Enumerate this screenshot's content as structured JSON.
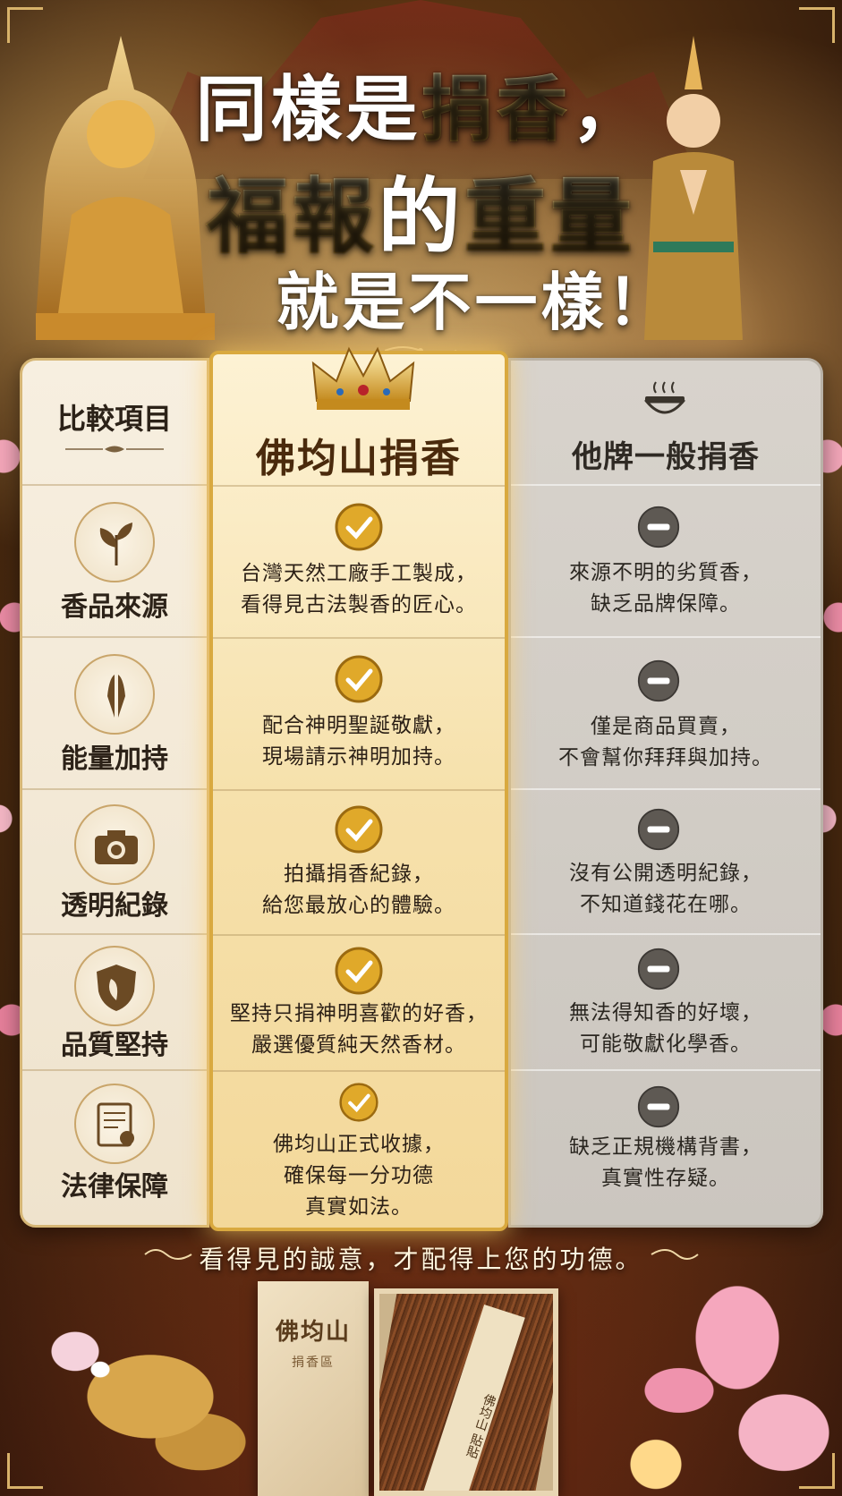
{
  "headline": {
    "line1_part1": "同樣是",
    "line1_part2": "捐香",
    "line1_punct": "，",
    "line2_part1": "福報",
    "line2_part2": "的",
    "line2_part3": "重量",
    "line3": "就是不一樣！"
  },
  "table": {
    "header_label": "比較項目",
    "header_brand": "佛均山捐香",
    "header_other": "他牌一般捐香",
    "rows": [
      {
        "label": "香品來源",
        "icon": "leaf-icon",
        "brand_line1": "台灣天然工廠手工製成，",
        "brand_line2": "看得見古法製香的匠心。",
        "other_line1": "來源不明的劣質香，",
        "other_line2": "缺乏品牌保障。"
      },
      {
        "label": "能量加持",
        "icon": "praying-hands-icon",
        "brand_line1": "配合神明聖誕敬獻，",
        "brand_line2": "現場請示神明加持。",
        "other_line1": "僅是商品買賣，",
        "other_line2": "不會幫你拜拜與加持。"
      },
      {
        "label": "透明紀錄",
        "icon": "camera-icon",
        "brand_line1": "拍攝捐香紀錄，",
        "brand_line2": "給您最放心的體驗。",
        "other_line1": "沒有公開透明紀錄，",
        "other_line2": "不知道錢花在哪。"
      },
      {
        "label": "品質堅持",
        "icon": "shield-leaf-icon",
        "brand_line1": "堅持只捐神明喜歡的好香，",
        "brand_line2": "嚴選優質純天然香材。",
        "other_line1": "無法得知香的好壞，",
        "other_line2": "可能敬獻化學香。"
      },
      {
        "label": "法律保障",
        "icon": "certificate-icon",
        "brand_line1": "佛均山正式收據，",
        "brand_line2": "確保每一分功德",
        "brand_line3": "真實如法。",
        "other_line1": "缺乏正規機構背書，",
        "other_line2": "真實性存疑。"
      }
    ]
  },
  "tagline": "看得見的誠意，才配得上您的功德。",
  "product": {
    "box_title": "佛均山",
    "box_subtitle": "捐香區",
    "stick_label": "佛均山 貼貼"
  },
  "colors": {
    "gold": "#d9a93f",
    "brand_column": "#f6e1ac",
    "other_column": "#cbc6bf",
    "check": "#e0a92a",
    "minus": "#5e5953"
  }
}
